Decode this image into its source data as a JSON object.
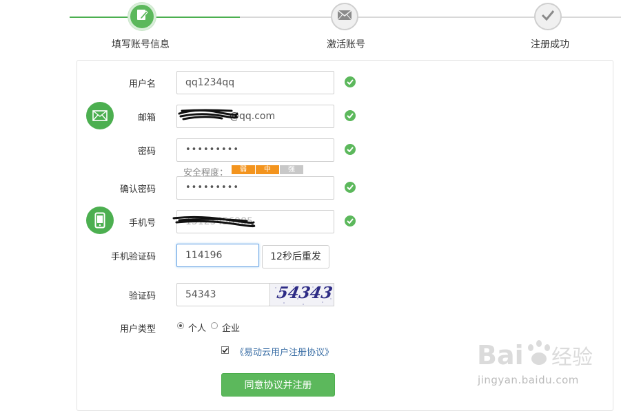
{
  "steps": [
    {
      "label": "填写账号信息",
      "state": "active",
      "icon": "edit-icon"
    },
    {
      "label": "激活账号",
      "state": "inactive",
      "icon": "envelope-icon"
    },
    {
      "label": "注册成功",
      "state": "inactive",
      "icon": "checkmark-icon"
    }
  ],
  "form": {
    "username": {
      "label": "用户名",
      "value": "qq1234qq",
      "valid": true
    },
    "email": {
      "label": "邮箱",
      "value": "5?????162@qq.com",
      "visible_suffix": "@qq.com",
      "valid": true
    },
    "password": {
      "label": "密码",
      "value": "•••••••••",
      "valid": true
    },
    "strength": {
      "label": "安全程度：",
      "levels": [
        "弱",
        "中",
        "强"
      ],
      "current": "中"
    },
    "confirm_password": {
      "label": "确认密码",
      "value": "•••••••••",
      "valid": true
    },
    "phone": {
      "label": "手机号",
      "value": "15123456985",
      "valid": true
    },
    "sms_code": {
      "label": "手机验证码",
      "value": "114196",
      "resend_label": "12秒后重发"
    },
    "captcha": {
      "label": "验证码",
      "value": "54343",
      "image_text": "54343"
    },
    "user_type": {
      "label": "用户类型",
      "options": [
        "个人",
        "企业"
      ],
      "selected": "个人"
    },
    "agreement": {
      "checked": true,
      "link_text": "《易动云用户注册协议》"
    },
    "submit_label": "同意协议并注册"
  },
  "watermark": {
    "brand": "Bai du 经验",
    "url": "jingyan.baidu.com"
  },
  "colors": {
    "accent_green": "#5cb85c",
    "strength_orange": "#f3941e",
    "link_blue": "#3a6ea5"
  }
}
